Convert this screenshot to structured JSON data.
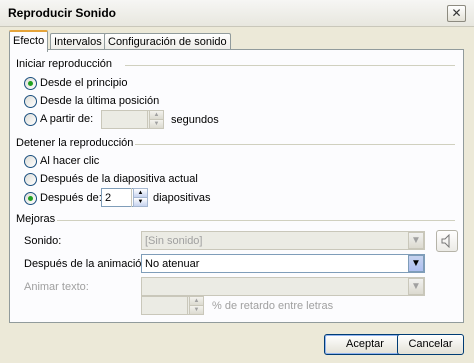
{
  "window": {
    "title": "Reproducir Sonido",
    "close_glyph": "✕"
  },
  "tabs": [
    "Efecto",
    "Intervalos",
    "Configuración de sonido"
  ],
  "start": {
    "group_label": "Iniciar reproducción",
    "opt_beginning": "Desde el principio",
    "opt_last_position": "Desde la última posición",
    "opt_from": "A partir de:",
    "from_value": "",
    "from_unit": "segundos",
    "selected": "beginning"
  },
  "stop": {
    "group_label": "Detener la reproducción",
    "opt_on_click": "Al hacer clic",
    "opt_after_current": "Después de la diapositiva actual",
    "opt_after": "Después de:",
    "after_value": "2",
    "after_unit": "diapositivas",
    "selected": "after"
  },
  "enhancements": {
    "group_label": "Mejoras",
    "sound_label": "Sonido:",
    "sound_value": "[Sin sonido]",
    "after_animation_label": "Después de la animación:",
    "after_animation_value": "No atenuar",
    "animate_text_label": "Animar texto:",
    "animate_text_value": "",
    "delay_value": "",
    "delay_unit": "% de retardo entre letras",
    "sound_icon": "speaker-icon"
  },
  "buttons": {
    "ok": "Aceptar",
    "cancel": "Cancelar"
  },
  "colors": {
    "radio_dot": "#21a121",
    "tab_highlight": "#e5a43a",
    "field_border": "#7f9db9"
  }
}
